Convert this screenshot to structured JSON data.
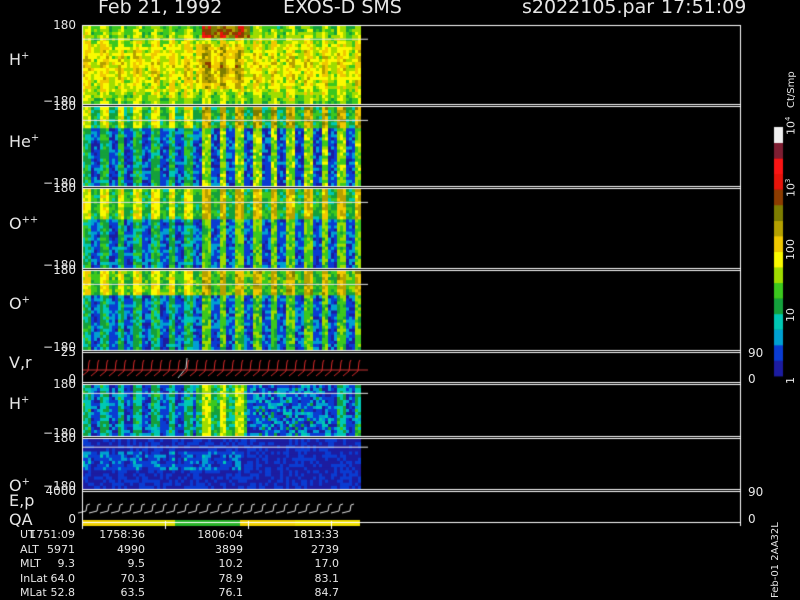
{
  "header": {
    "date": "Feb 21, 1992",
    "instrument": "EXOS-D SMS",
    "file": "s2022105.par",
    "time": "17:51:09"
  },
  "colorbar": {
    "unit": "Ct/Smp",
    "labels": [
      {
        "key": "1",
        "text": "1",
        "value": 1
      },
      {
        "key": "10",
        "text": "10",
        "value": 10
      },
      {
        "key": "100",
        "text": "100",
        "value": 100
      },
      {
        "key": "1e3",
        "text": "10",
        "sup": "3",
        "value": 1000
      },
      {
        "key": "1e4",
        "text": "10",
        "sup": "4",
        "value": 10000
      }
    ],
    "colors": [
      "#1c1ca0",
      "#0a3cd2",
      "#00a0d2",
      "#00c8b4",
      "#14a03c",
      "#3cc81e",
      "#a0dc00",
      "#fafa00",
      "#f0c800",
      "#b4a000",
      "#7d7d00",
      "#8c3c00",
      "#e6140a",
      "#fa1414",
      "#7d1e32",
      "#f0f0f0"
    ]
  },
  "panels": [
    {
      "id": "h-plus",
      "label": "H",
      "sup": "+",
      "ticks": [
        "180",
        "−180"
      ]
    },
    {
      "id": "he-plus",
      "label": "He",
      "sup": "+",
      "ticks": [
        "180",
        "−180"
      ]
    },
    {
      "id": "o-plus-plus",
      "label": "O",
      "sup": "++",
      "ticks": [
        "180",
        "−180"
      ]
    },
    {
      "id": "o-plus",
      "label": "O",
      "sup": "+",
      "ticks": [
        "180",
        "−180"
      ]
    },
    {
      "id": "v-r",
      "label": "V,r",
      "sup": "",
      "ticks": [
        "25",
        "0"
      ],
      "right_ticks": [
        "90",
        "0"
      ]
    },
    {
      "id": "h-plus-2",
      "label": "H",
      "sup": "+",
      "ticks": [
        "180",
        "−180"
      ]
    },
    {
      "id": "o-plus-2",
      "label": "O",
      "sup": "+",
      "ticks": [
        "180",
        "−180"
      ]
    },
    {
      "id": "e-p",
      "label": "E,p",
      "sup": "",
      "ticks": [
        "4000",
        "0"
      ],
      "right_ticks": [
        "90",
        "0"
      ]
    }
  ],
  "qa_label": "QA",
  "table": {
    "rows": [
      {
        "label": "UT",
        "values": [
          "1751:09",
          "1758:36",
          "1806:04",
          "1813:33"
        ]
      },
      {
        "label": "ALT",
        "values": [
          "5971",
          "4990",
          "3899",
          "2739"
        ]
      },
      {
        "label": "MLT",
        "values": [
          "9.3",
          "9.5",
          "10.2",
          "17.0"
        ]
      },
      {
        "label": "InLat",
        "values": [
          "64.0",
          "70.3",
          "78.9",
          "83.1"
        ]
      },
      {
        "label": "MLat",
        "values": [
          "52.8",
          "63.5",
          "76.1",
          "84.7"
        ]
      }
    ]
  },
  "footer_note": "Feb-01 2AA32L",
  "chart_data": {
    "type": "heatmap",
    "title": "Feb 21, 1992   EXOS-D SMS",
    "x_ticks": [
      "1751:09",
      "1758:36",
      "1806:04",
      "1813:33"
    ],
    "color_scale": "log",
    "color_range": [
      1,
      10000
    ],
    "color_unit": "Ct/Smp",
    "panels": [
      {
        "name": "H+",
        "ylim": [
          -180,
          180
        ]
      },
      {
        "name": "He+",
        "ylim": [
          -180,
          180
        ]
      },
      {
        "name": "O++",
        "ylim": [
          -180,
          180
        ]
      },
      {
        "name": "O+",
        "ylim": [
          -180,
          180
        ]
      },
      {
        "name": "V,r",
        "ylim": [
          0,
          25
        ],
        "ylim_right": [
          0,
          90
        ]
      },
      {
        "name": "H+",
        "ylim": [
          -180,
          180
        ]
      },
      {
        "name": "O+",
        "ylim": [
          -180,
          180
        ]
      },
      {
        "name": "E,p",
        "ylim": [
          0,
          4000
        ],
        "ylim_right": [
          0,
          90
        ]
      }
    ]
  }
}
